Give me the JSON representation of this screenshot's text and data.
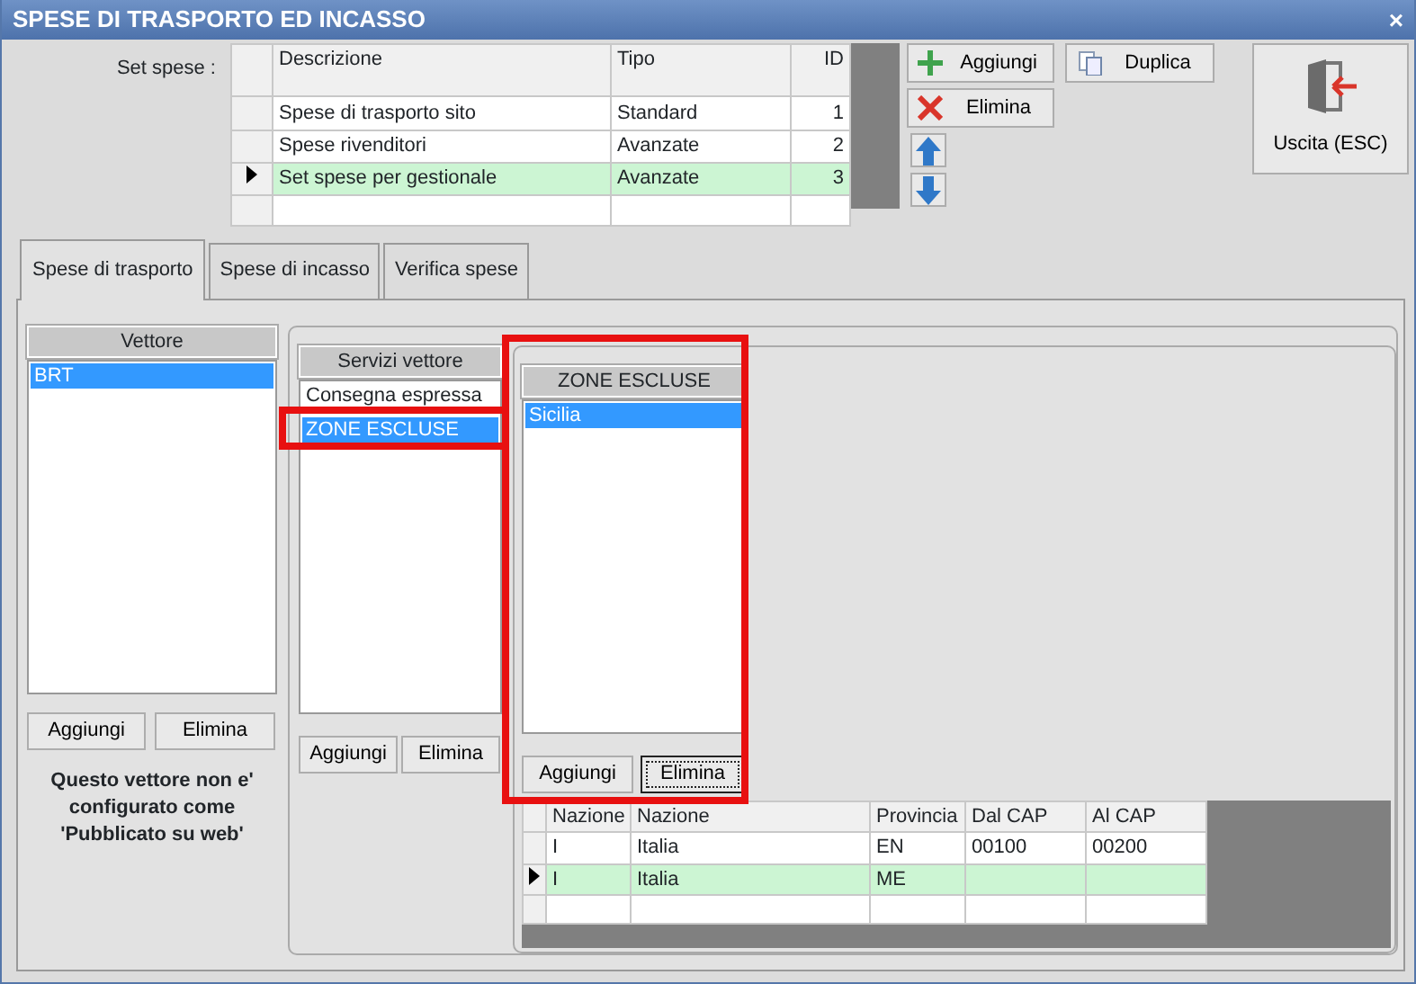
{
  "window": {
    "title": "SPESE DI TRASPORTO ED INCASSO",
    "close": "×"
  },
  "set_spese": {
    "label": "Set spese :",
    "columns": [
      "Descrizione",
      "Tipo",
      "ID"
    ],
    "rows": [
      {
        "cells": [
          "Spese di trasporto sito",
          "Standard",
          "1"
        ],
        "selected": false
      },
      {
        "cells": [
          "Spese rivenditori",
          "Avanzate",
          "2"
        ],
        "selected": false
      },
      {
        "cells": [
          "Set spese per gestionale",
          "Avanzate",
          "3"
        ],
        "selected": true
      }
    ]
  },
  "toolbar": [
    {
      "kind": "add",
      "label": "Aggiungi"
    },
    {
      "kind": "copy",
      "label": "Duplica"
    },
    {
      "kind": "delete",
      "label": "Elimina"
    },
    {
      "kind": "up"
    },
    {
      "kind": "down"
    }
  ],
  "exit_button": {
    "label": "Uscita (ESC)"
  },
  "tabs": [
    {
      "label": "Spese di trasporto",
      "selected": true
    },
    {
      "label": "Spese di incasso",
      "selected": false
    },
    {
      "label": "Verifica spese",
      "selected": false
    }
  ],
  "vettore": {
    "header": "Vettore",
    "items": [
      {
        "label": "BRT",
        "selected": true
      }
    ],
    "buttons": [
      {
        "label": "Aggiungi",
        "focused": false
      },
      {
        "label": "Elimina",
        "focused": false
      }
    ],
    "message": "Questo vettore non e' configurato come 'Pubblicato su web'"
  },
  "servizi": {
    "header": "Servizi vettore",
    "items": [
      {
        "label": "Consegna espressa",
        "selected": false,
        "highlighted": false
      },
      {
        "label": "ZONE ESCLUSE",
        "selected": true,
        "highlighted": true
      }
    ],
    "buttons": [
      {
        "label": "Aggiungi",
        "focused": false
      },
      {
        "label": "Elimina",
        "focused": false
      }
    ]
  },
  "zone": {
    "header": "ZONE ESCLUSE",
    "highlighted": true,
    "items": [
      {
        "label": "Sicilia",
        "selected": true
      }
    ],
    "buttons": [
      {
        "label": "Aggiungi",
        "focused": false
      },
      {
        "label": "Elimina",
        "focused": true
      }
    ]
  },
  "zone_grid": {
    "columns": [
      "Nazione",
      "Nazione",
      "Provincia",
      "Dal CAP",
      "Al CAP"
    ],
    "rows": [
      {
        "cells": [
          "I",
          "Italia",
          "EN",
          "00100",
          "00200"
        ],
        "selected": false
      },
      {
        "cells": [
          "I",
          "Italia",
          "ME"
        ],
        "selected": true
      }
    ]
  }
}
